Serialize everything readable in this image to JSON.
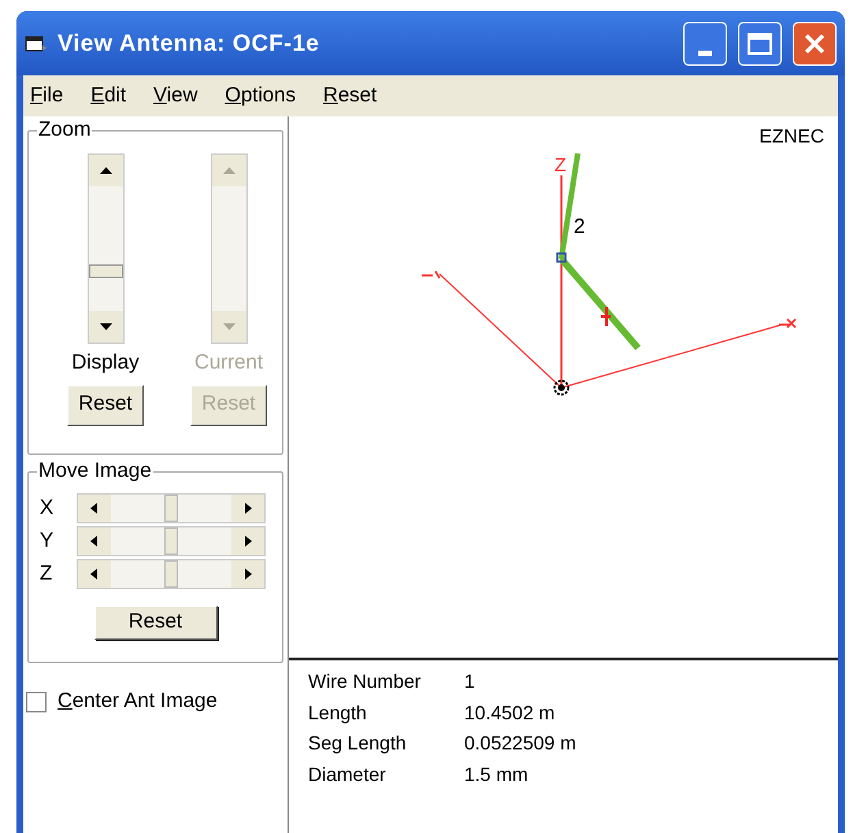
{
  "window": {
    "title": "View Antenna: OCF-1e"
  },
  "menu": [
    "File",
    "Edit",
    "View",
    "Options",
    "Reset"
  ],
  "zoom": {
    "title": "Zoom",
    "columns": [
      {
        "label": "Display",
        "disabled": false,
        "button": "Reset"
      },
      {
        "label": "Current",
        "disabled": true,
        "button": "Reset"
      }
    ]
  },
  "move_image": {
    "title": "Move Image",
    "axes": [
      "X",
      "Y",
      "Z"
    ],
    "button": "Reset"
  },
  "center_checkbox": {
    "label": "Center Ant Image",
    "checked": false
  },
  "view": {
    "brand": "EZNEC",
    "axis_label": "Z",
    "wire_label": "2"
  },
  "info": [
    {
      "label": "Wire Number",
      "value": "1"
    },
    {
      "label": "Length",
      "value": "10.4502 m"
    },
    {
      "label": "Seg Length",
      "value": "0.0522509 m"
    },
    {
      "label": "Diameter",
      "value": "1.5 mm"
    }
  ]
}
